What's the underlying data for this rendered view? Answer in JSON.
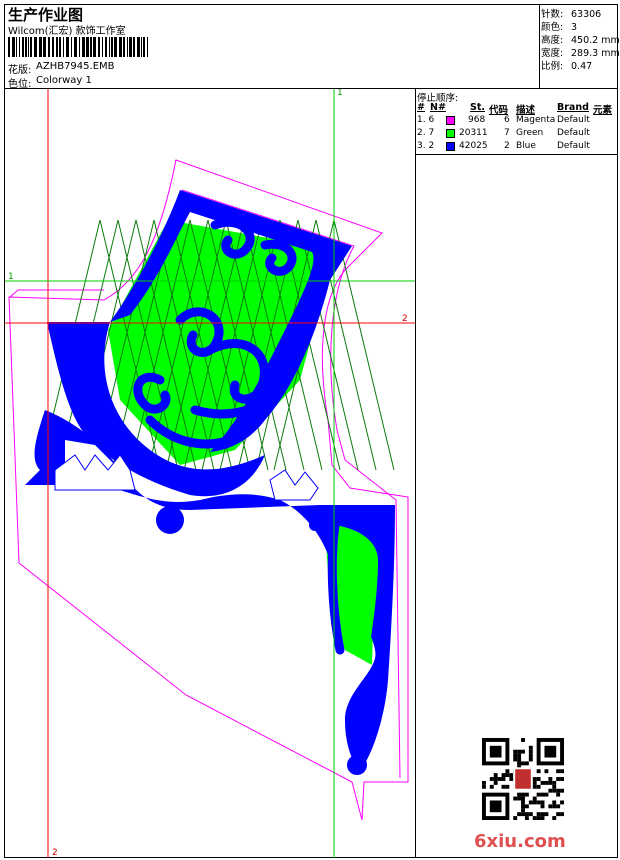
{
  "header": {
    "title": "生产作业图",
    "company": "Wilcom(汇宏) 款饰工作室",
    "design_label": "花版:",
    "design_value": "AZHB7945.EMB",
    "colorway_label": "色位:",
    "colorway_value": "Colorway 1"
  },
  "info": {
    "stitches_label": "针数:",
    "stitches": "63306",
    "colors_label": "颜色:",
    "colors": "3",
    "height_label": "高度:",
    "height": "450.2 mm",
    "width_label": "宽度:",
    "width": "289.3 mm",
    "scale_label": "比例:",
    "scale": "0.47"
  },
  "legend": {
    "title": "停止顺序:",
    "headers": [
      "#",
      "N#",
      "St.",
      "代码",
      "描述",
      "Brand",
      "元素"
    ],
    "rows": [
      {
        "order": "1. 6",
        "stitches": "968",
        "code": "6",
        "name": "Magenta",
        "brand": "Default",
        "color": "#ff00ff"
      },
      {
        "order": "2. 7",
        "stitches": "20311",
        "code": "7",
        "name": "Green",
        "brand": "Default",
        "color": "#00ff00"
      },
      {
        "order": "3. 2",
        "stitches": "42025",
        "code": "2",
        "name": "Blue",
        "brand": "Default",
        "color": "#0000ff"
      }
    ]
  },
  "canvas": {
    "guide_labels": {
      "v_green": "1",
      "h_green": "1",
      "h_red": "2",
      "v_red": "2"
    },
    "colors": {
      "guide_red": "#ff0000",
      "guide_green": "#00d000",
      "outline": "#ff00ff",
      "fill_blue": "#0000ff",
      "fill_green": "#00ff00"
    }
  },
  "watermark": "6xiu.com"
}
